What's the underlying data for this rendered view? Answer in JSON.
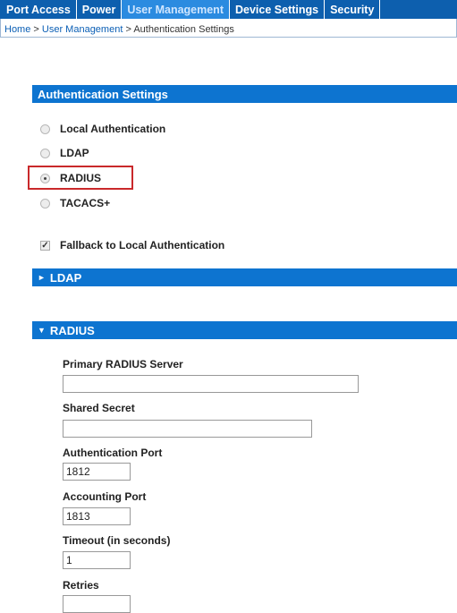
{
  "nav": {
    "tabs": [
      {
        "label": "Port Access"
      },
      {
        "label": "Power"
      },
      {
        "label": "User Management"
      },
      {
        "label": "Device Settings"
      },
      {
        "label": "Security"
      }
    ]
  },
  "breadcrumb": {
    "home": "Home",
    "sep1": " > ",
    "user_mgmt": "User Management",
    "sep2": " > ",
    "current": "Authentication Settings"
  },
  "auth_settings": {
    "title": "Authentication Settings",
    "options": [
      {
        "label": "Local Authentication",
        "checked": false
      },
      {
        "label": "LDAP",
        "checked": false
      },
      {
        "label": "RADIUS",
        "checked": true
      },
      {
        "label": "TACACS+",
        "checked": false
      }
    ],
    "fallback_label": "Fallback to Local Authentication",
    "fallback_checked": true
  },
  "ldap_section": {
    "title": "LDAP",
    "expanded": false
  },
  "radius_section": {
    "title": "RADIUS",
    "expanded": true,
    "fields": {
      "primary_server": {
        "label": "Primary RADIUS Server",
        "value": ""
      },
      "shared_secret": {
        "label": "Shared Secret",
        "value": ""
      },
      "auth_port": {
        "label": "Authentication Port",
        "value": "1812"
      },
      "acct_port": {
        "label": "Accounting Port",
        "value": "1813"
      },
      "timeout": {
        "label": "Timeout (in seconds)",
        "value": "1"
      },
      "retries": {
        "label": "Retries",
        "value": ""
      }
    }
  },
  "colors": {
    "nav_bg": "#0d5fae",
    "nav_active": "#2b8be0",
    "section_bar": "#0d74d0",
    "highlight": "#c9292b"
  }
}
